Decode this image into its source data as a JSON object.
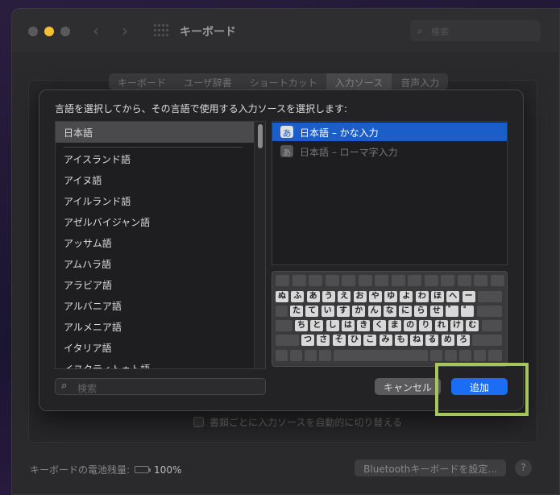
{
  "window": {
    "title": "キーボード",
    "search_placeholder": "検索"
  },
  "tabs": [
    "キーボード",
    "ユーザ辞書",
    "ショートカット",
    "入力ソース",
    "音声入力"
  ],
  "selected_tab": 3,
  "sheet": {
    "prompt": "言語を選択してから、その言語で使用する入力ソースを選択します:",
    "languages": [
      "日本語",
      "アイスランド語",
      "アイヌ語",
      "アイルランド語",
      "アゼルバイジャン語",
      "アッサム語",
      "アムハラ語",
      "アラビア語",
      "アルバニア語",
      "アルメニア語",
      "イタリア語",
      "イヌクティトゥト語"
    ],
    "selected_language": "日本語",
    "sources": [
      {
        "icon": "あ",
        "label": "日本語 – かな入力",
        "selected": true
      },
      {
        "icon": "あ",
        "label": "日本語 – ローマ字入力",
        "selected": false
      }
    ],
    "keyboard_rows": [
      [
        "ぬ",
        "ふ",
        "あ",
        "う",
        "え",
        "お",
        "や",
        "ゆ",
        "よ",
        "わ",
        "ほ",
        "へ",
        "ー"
      ],
      [
        "た",
        "て",
        "い",
        "す",
        "か",
        "ん",
        "な",
        "に",
        "ら",
        "せ",
        "゛",
        "゜"
      ],
      [
        "ち",
        "と",
        "し",
        "は",
        "き",
        "く",
        "ま",
        "の",
        "り",
        "れ",
        "け",
        "む"
      ],
      [
        "つ",
        "さ",
        "そ",
        "ひ",
        "こ",
        "み",
        "も",
        "ね",
        "る",
        "め",
        "ろ"
      ]
    ],
    "search_placeholder": "検索",
    "cancel_label": "キャンセル",
    "add_label": "追加"
  },
  "footer": {
    "auto_switch_label": "書類ごとに入力ソースを自動的に切り替える",
    "battery_label": "キーボードの電池残量:",
    "battery_value": "100%",
    "bluetooth_button": "Bluetoothキーボードを設定...",
    "help": "?"
  },
  "colors": {
    "accent": "#1b6ef3",
    "selection": "#1b5ec9",
    "highlight_box": "#a4c65c",
    "traffic_min": "#f5bf2f"
  }
}
